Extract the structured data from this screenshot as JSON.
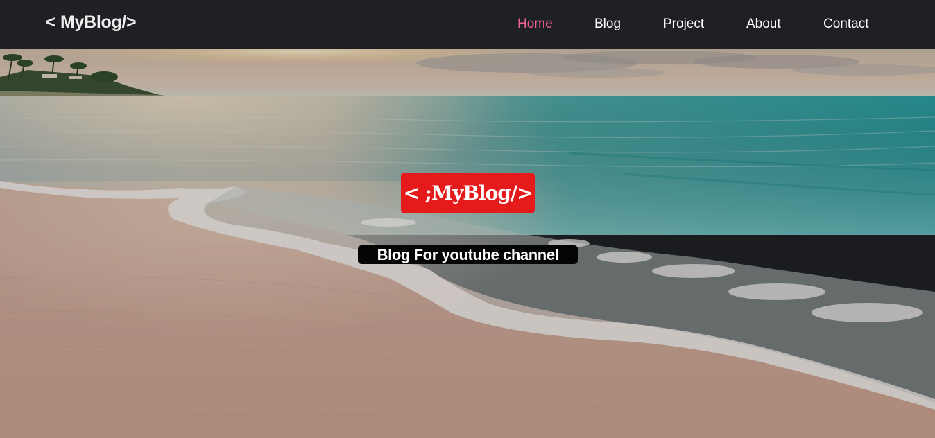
{
  "nav": {
    "logo": "< MyBlog/>",
    "links": [
      {
        "label": "Home",
        "active": true
      },
      {
        "label": "Blog",
        "active": false
      },
      {
        "label": "Project",
        "active": false
      },
      {
        "label": "About",
        "active": false
      },
      {
        "label": "Contact",
        "active": false
      }
    ],
    "active_color": "#f06292",
    "background_color": "#1f2024"
  },
  "hero": {
    "title": "< ;MyBlog/>",
    "subtitle": "Blog For youtube channel",
    "title_background": "#e51b1b",
    "subtitle_background": "#050505",
    "background_image": "beach-sunset-image"
  }
}
